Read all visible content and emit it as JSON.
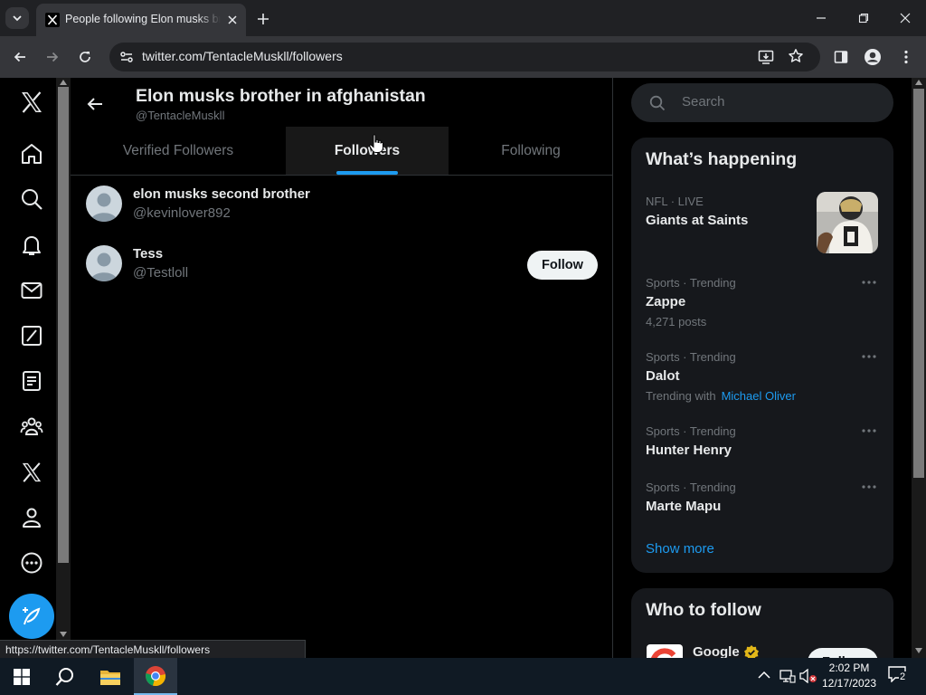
{
  "browser": {
    "tab_title": "People following Elon musks brother in afghanistan",
    "url": "twitter.com/TentacleMuskll/followers",
    "status_url": "https://twitter.com/TentacleMuskll/followers"
  },
  "profile": {
    "name": "Elon musks brother in afghanistan",
    "handle": "@TentacleMuskll"
  },
  "tabs": [
    {
      "label": "Verified Followers",
      "active": false
    },
    {
      "label": "Followers",
      "active": true
    },
    {
      "label": "Following",
      "active": false
    }
  ],
  "followers": [
    {
      "name": "elon musks second brother",
      "handle": "@kevinlover892",
      "follow_label": ""
    },
    {
      "name": "Tess",
      "handle": "@Testloll",
      "follow_label": "Follow"
    }
  ],
  "search": {
    "placeholder": "Search"
  },
  "trends": {
    "title": "What’s happening",
    "items": [
      {
        "meta": "NFL · LIVE",
        "name": "Giants at Saints",
        "sub": ""
      },
      {
        "meta": "Sports · Trending",
        "name": "Zappe",
        "sub": "4,271 posts"
      },
      {
        "meta": "Sports · Trending",
        "name": "Dalot",
        "sub": "Trending with",
        "link": "Michael Oliver"
      },
      {
        "meta": "Sports · Trending",
        "name": "Hunter Henry",
        "sub": ""
      },
      {
        "meta": "Sports · Trending",
        "name": "Marte Mapu",
        "sub": ""
      }
    ],
    "show_more": "Show more"
  },
  "who_to_follow": {
    "title": "Who to follow",
    "items": [
      {
        "name": "Google",
        "follow_label": "Follow"
      }
    ]
  },
  "taskbar": {
    "time": "2:02 PM",
    "date": "12/17/2023",
    "notification_count": "2"
  },
  "colors": {
    "accent": "#1d9bf0",
    "background": "#000000",
    "panel": "#16181c",
    "muted_text": "#71767b"
  },
  "icons": [
    "x-logo-icon",
    "home-icon",
    "explore-icon",
    "notifications-icon",
    "messages-icon",
    "grok-icon",
    "lists-icon",
    "communities-icon",
    "premium-icon",
    "profile-icon",
    "more-icon",
    "compose-icon"
  ]
}
